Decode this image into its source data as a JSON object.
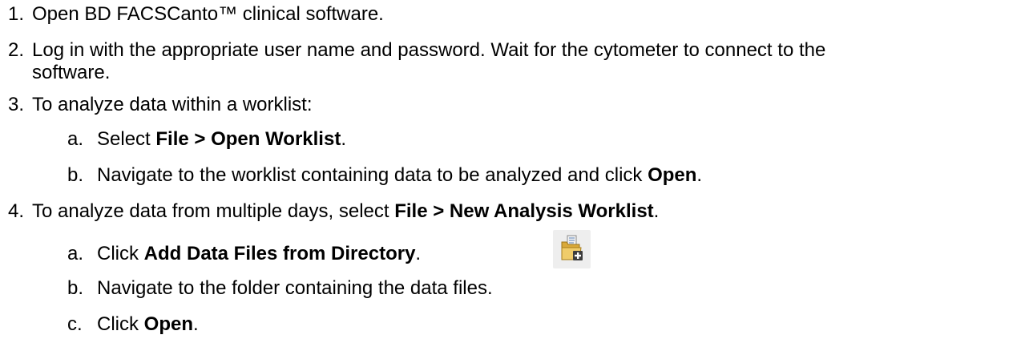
{
  "steps": [
    {
      "num": "1.",
      "text": "Open BD FACSCanto™ clinical software."
    },
    {
      "num": "2.",
      "line1": "Log in with the appropriate user name and password. Wait for the cytometer to connect to the",
      "line2": "software."
    },
    {
      "num": "3.",
      "text": "To analyze data within a worklist:",
      "substeps": [
        {
          "letter": "a.",
          "pre": "Select ",
          "bold": "File > Open Worklist",
          "post": "."
        },
        {
          "letter": "b.",
          "pre": "Navigate to the worklist containing data to be analyzed and click ",
          "bold": "Open",
          "post": "."
        }
      ]
    },
    {
      "num": "4.",
      "pre": "To analyze data from multiple days, select ",
      "bold": "File > New Analysis Worklist",
      "post": ".",
      "substeps": [
        {
          "letter": "a.",
          "pre": "Click ",
          "bold": "Add Data Files from Directory",
          "post": ".",
          "icon": "add-folder-icon"
        },
        {
          "letter": "b.",
          "pre": "Navigate to the folder containing the data files.",
          "bold": "",
          "post": ""
        },
        {
          "letter": "c.",
          "pre": "Click ",
          "bold": "Open",
          "post": "."
        }
      ]
    }
  ]
}
